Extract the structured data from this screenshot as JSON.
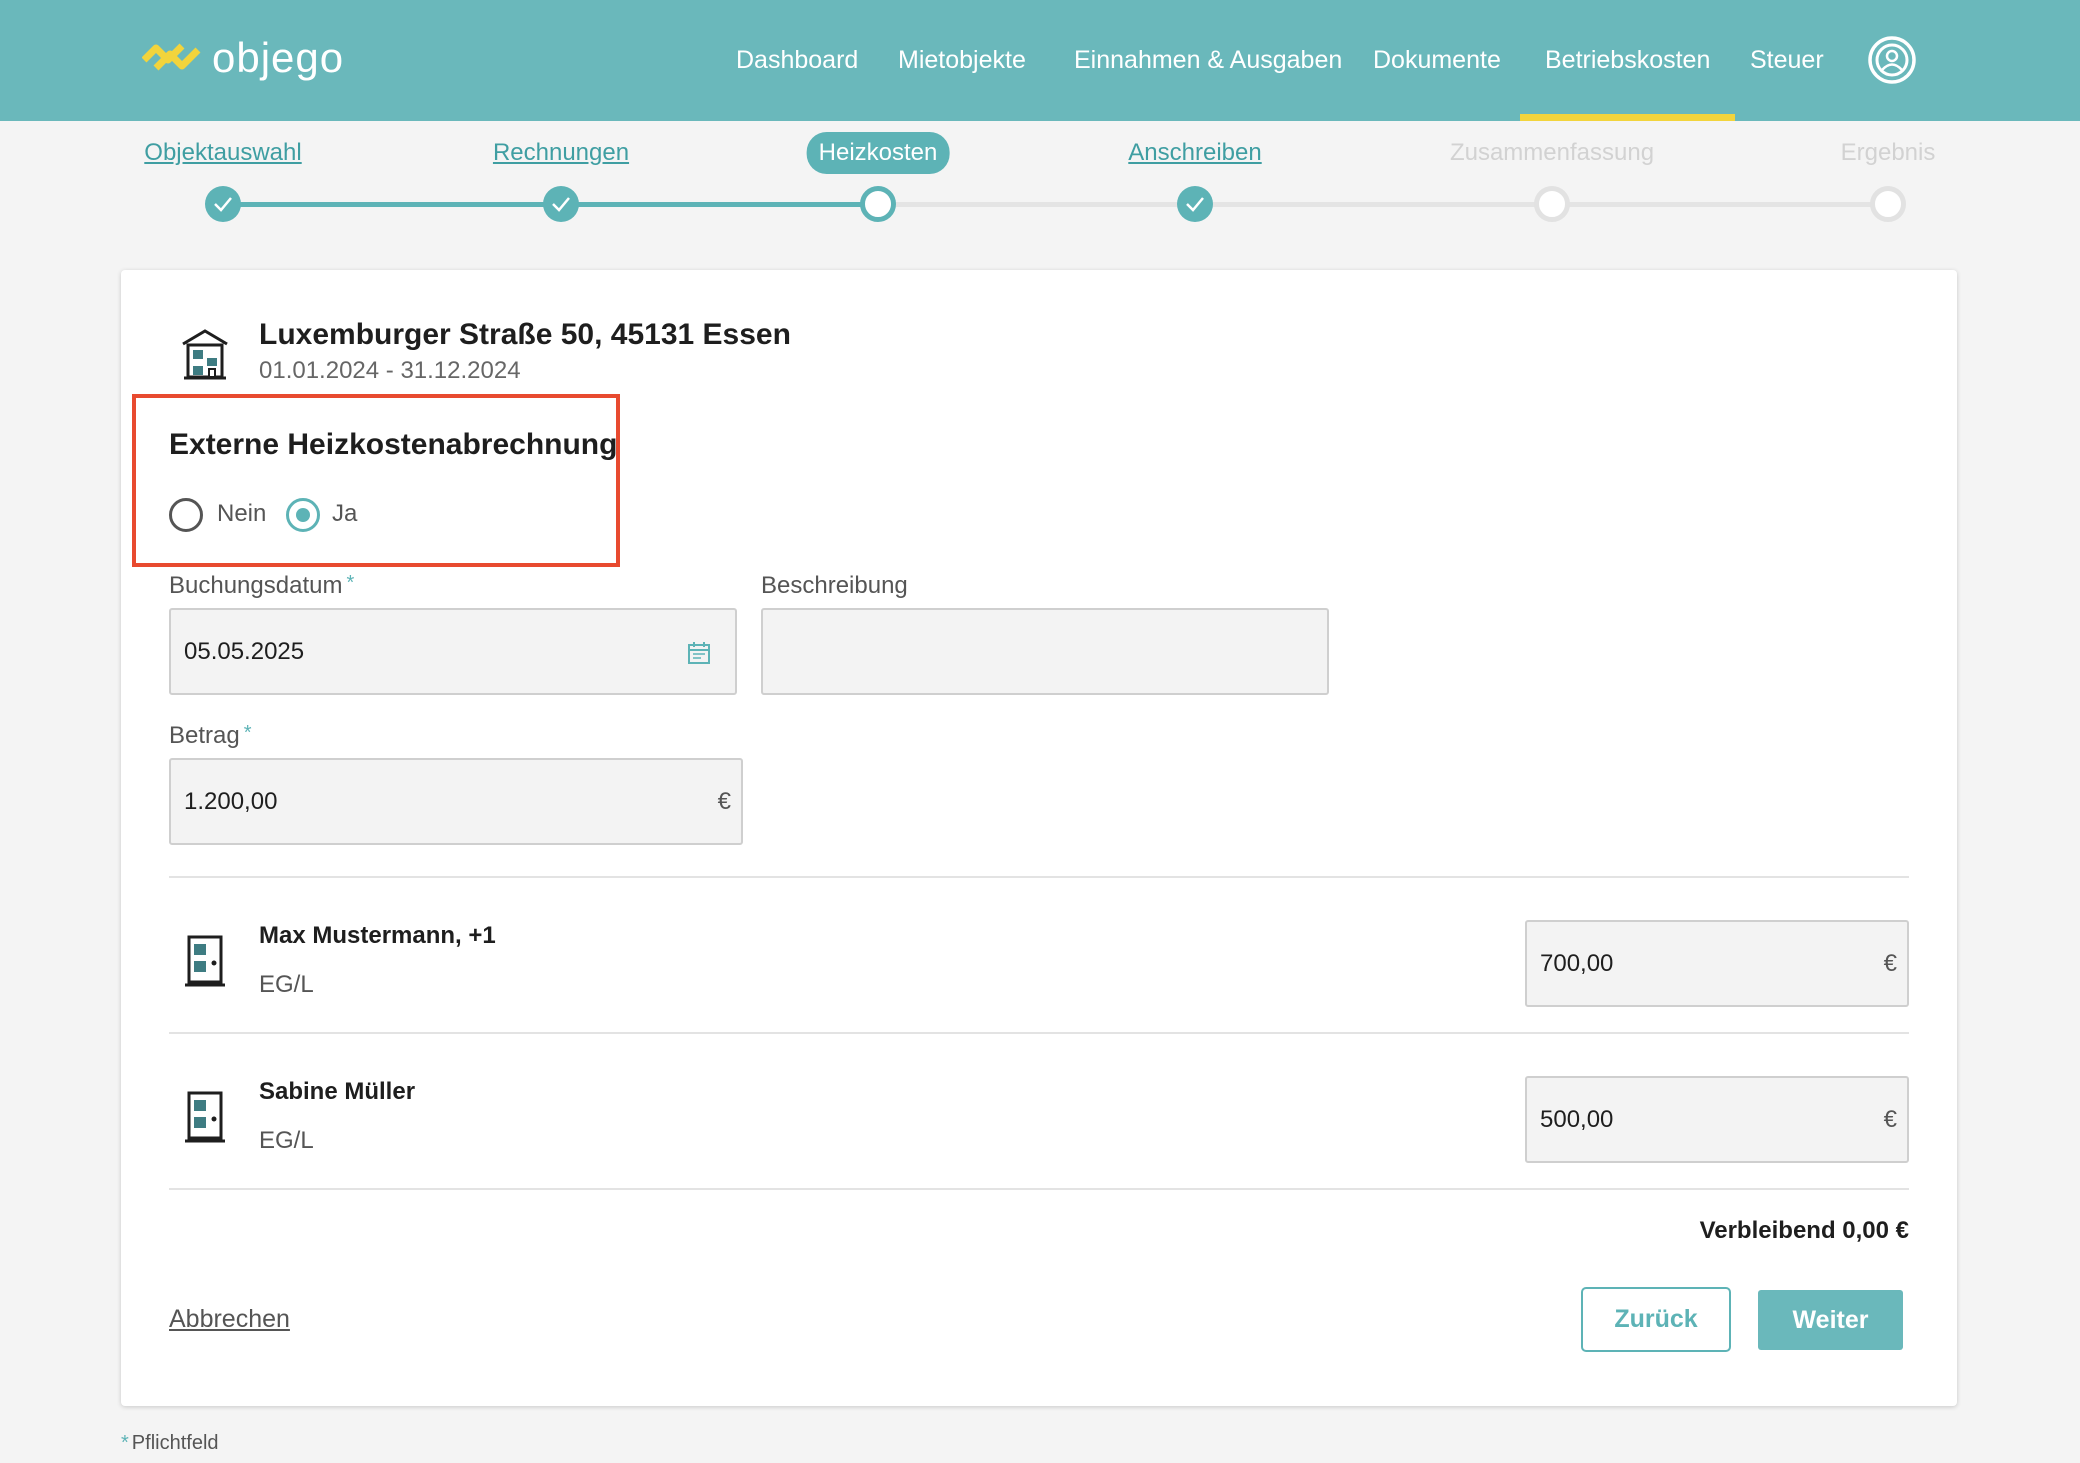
{
  "brand": {
    "name": "objego"
  },
  "nav": {
    "items": [
      "Dashboard",
      "Mietobjekte",
      "Einnahmen & Ausgaben",
      "Dokumente",
      "Betriebskosten",
      "Steuer"
    ],
    "active": "Betriebskosten",
    "account_icon": "user-circle-icon"
  },
  "stepper": {
    "steps": [
      {
        "label": "Objektauswahl",
        "state": "done"
      },
      {
        "label": "Rechnungen",
        "state": "done"
      },
      {
        "label": "Heizkosten",
        "state": "current"
      },
      {
        "label": "Anschreiben",
        "state": "done"
      },
      {
        "label": "Zusammenfassung",
        "state": "pending"
      },
      {
        "label": "Ergebnis",
        "state": "pending"
      }
    ]
  },
  "property": {
    "title": "Luxemburger Straße 50, 45131 Essen",
    "period": "01.01.2024 - 31.12.2024"
  },
  "external_billing": {
    "title": "Externe Heizkostenabrechnung",
    "options": [
      "Nein",
      "Ja"
    ],
    "selected": "Ja"
  },
  "form": {
    "booking_date": {
      "label": "Buchungsdatum",
      "required_mark": "*",
      "value": "05.05.2025"
    },
    "description": {
      "label": "Beschreibung",
      "value": ""
    },
    "amount": {
      "label": "Betrag",
      "required_mark": "*",
      "value": "1.200,00",
      "currency": "€"
    }
  },
  "tenants": [
    {
      "name": "Max Mustermann, +1",
      "unit": "EG/L",
      "amount": "700,00",
      "currency": "€"
    },
    {
      "name": "Sabine Müller",
      "unit": "EG/L",
      "amount": "500,00",
      "currency": "€"
    }
  ],
  "remaining": "Verbleibend 0,00 €",
  "actions": {
    "cancel": "Abbrechen",
    "back": "Zurück",
    "next": "Weiter"
  },
  "footer": {
    "required_star": "*",
    "required_note": "Pflichtfeld"
  },
  "colors": {
    "primary": "#6ab8bb",
    "accent": "#f2d43c",
    "highlight": "#e84a2f"
  }
}
